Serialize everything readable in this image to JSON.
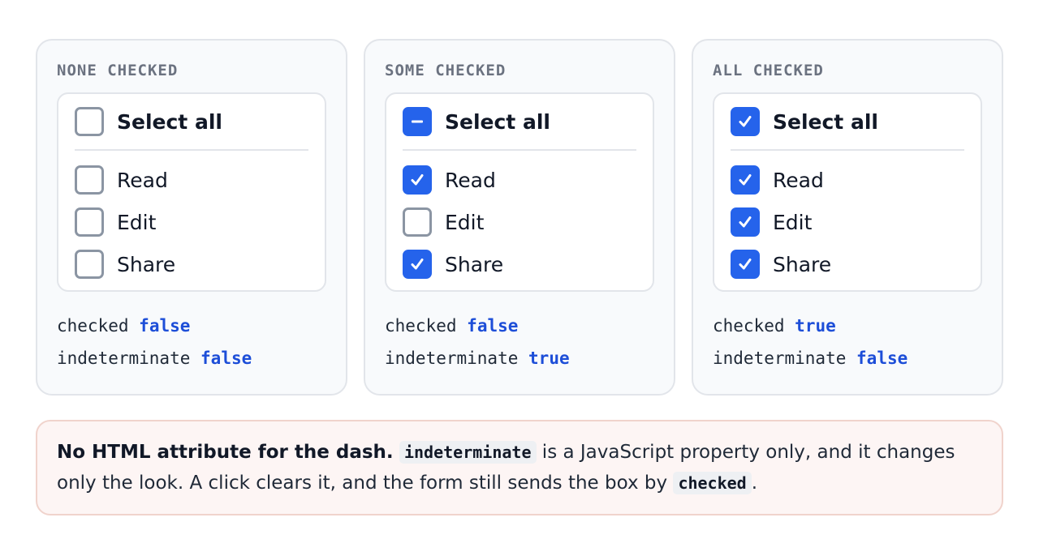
{
  "colors": {
    "accent": "#2563eb",
    "value": "#1d4ed8",
    "note_bg": "#fdf5f4",
    "note_border": "#f0d3cc"
  },
  "cards": [
    {
      "title": "NONE CHECKED",
      "select_all": {
        "label": "Select all",
        "state": "unchecked",
        "icon": "empty"
      },
      "items": [
        {
          "label": "Read",
          "checked": false
        },
        {
          "label": "Edit",
          "checked": false
        },
        {
          "label": "Share",
          "checked": false
        }
      ],
      "checked_key": "checked",
      "checked_value": "false",
      "indeterminate_key": "indeterminate",
      "indeterminate_value": "false"
    },
    {
      "title": "SOME CHECKED",
      "select_all": {
        "label": "Select all",
        "state": "indeterminate",
        "icon": "dash-icon"
      },
      "items": [
        {
          "label": "Read",
          "checked": true
        },
        {
          "label": "Edit",
          "checked": false
        },
        {
          "label": "Share",
          "checked": true
        }
      ],
      "checked_key": "checked",
      "checked_value": "false",
      "indeterminate_key": "indeterminate",
      "indeterminate_value": "true"
    },
    {
      "title": "ALL CHECKED",
      "select_all": {
        "label": "Select all",
        "state": "checked",
        "icon": "checkmark-icon"
      },
      "items": [
        {
          "label": "Read",
          "checked": true
        },
        {
          "label": "Edit",
          "checked": true
        },
        {
          "label": "Share",
          "checked": true
        }
      ],
      "checked_key": "checked",
      "checked_value": "true",
      "indeterminate_key": "indeterminate",
      "indeterminate_value": "false"
    }
  ],
  "note": {
    "lead": "No HTML attribute for the dash.",
    "code1": "indeterminate",
    "text1": " is a JavaScript property only, and it changes only the look. A click clears it, and the form still sends the box by ",
    "code2": "checked",
    "text2": "."
  }
}
